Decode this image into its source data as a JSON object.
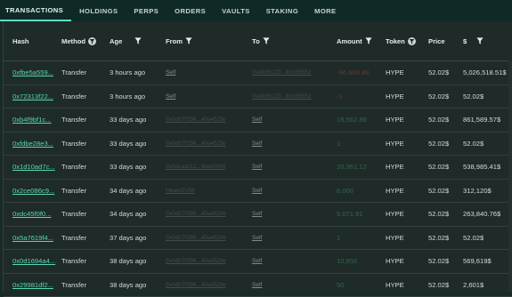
{
  "nav": {
    "items": [
      "TRANSACTIONS",
      "HOLDINGS",
      "PERPS",
      "ORDERS",
      "VAULTS",
      "STAKING",
      "MORE"
    ],
    "active_index": 0
  },
  "table": {
    "headers": {
      "hash": "Hash",
      "method": "Method",
      "age": "Age",
      "from": "From",
      "to": "To",
      "amount": "Amount",
      "token": "Token",
      "price": "Price",
      "usd": "$"
    },
    "rows": [
      {
        "hash": "0xfbe5a559...",
        "method": "Transfer",
        "age": "3 hours ago",
        "from": "Self",
        "to": "0xab3fc22f...8c085552",
        "amount": "-96,609.48",
        "amount_sign": "neg",
        "token": "HYPE",
        "price": "52.02$",
        "usd": "5,026,518.51$"
      },
      {
        "hash": "0x72313f22...",
        "method": "Transfer",
        "age": "3 hours ago",
        "from": "Self",
        "to": "0xab3fc22f...8c085552",
        "amount": "-1",
        "amount_sign": "neg",
        "token": "HYPE",
        "price": "52.02$",
        "usd": "52.02$"
      },
      {
        "hash": "0xb4f9bf1c...",
        "method": "Transfer",
        "age": "33 days ago",
        "from": "0x0d07f296...40a452fe",
        "to": "Self",
        "amount": "16,562.86",
        "amount_sign": "pos",
        "token": "HYPE",
        "price": "52.02$",
        "usd": "861,589.57$"
      },
      {
        "hash": "0xfdbe28e3...",
        "method": "Transfer",
        "age": "33 days ago",
        "from": "0x0d07f296...40a452fe",
        "to": "Self",
        "amount": "1",
        "amount_sign": "pos",
        "token": "HYPE",
        "price": "52.02$",
        "usd": "52.02$"
      },
      {
        "hash": "0x1d10ad7c...",
        "method": "Transfer",
        "age": "33 days ago",
        "from": "0x5dcaaf12...6ba00f04",
        "to": "Self",
        "amount": "10,361.12",
        "amount_sign": "pos",
        "token": "HYPE",
        "price": "52.02$",
        "usd": "538,985.41$"
      },
      {
        "hash": "0x2ce086c9...",
        "method": "Transfer",
        "age": "34 days ago",
        "from": "HeaerEVM",
        "to": "Self",
        "amount": "6,000",
        "amount_sign": "pos",
        "token": "HYPE",
        "price": "52.02$",
        "usd": "312,120$"
      },
      {
        "hash": "0xdc45f0f0...",
        "method": "Transfer",
        "age": "34 days ago",
        "from": "0x0d07f296...40a452fe",
        "to": "Self",
        "amount": "5,071.91",
        "amount_sign": "pos",
        "token": "HYPE",
        "price": "52.02$",
        "usd": "263,840.76$"
      },
      {
        "hash": "0x5a7619f4...",
        "method": "Transfer",
        "age": "37 days ago",
        "from": "0x0d07f296...40a452fe",
        "to": "Self",
        "amount": "1",
        "amount_sign": "pos",
        "token": "HYPE",
        "price": "52.02$",
        "usd": "52.02$"
      },
      {
        "hash": "0x0d1694a4...",
        "method": "Transfer",
        "age": "38 days ago",
        "from": "0x0d07f296...40a452fe",
        "to": "Self",
        "amount": "10,950",
        "amount_sign": "pos",
        "token": "HYPE",
        "price": "52.02$",
        "usd": "569,619$"
      },
      {
        "hash": "0x29981df2...",
        "method": "Transfer",
        "age": "38 days ago",
        "from": "0x0d07f296...40a452fe",
        "to": "Self",
        "amount": "50",
        "amount_sign": "pos",
        "token": "HYPE",
        "price": "52.02$",
        "usd": "2,601$"
      }
    ]
  },
  "colors": {
    "accent": "#58d6b5",
    "negative": "#e0524c",
    "positive": "#5fc98a",
    "background": "#1e2b29",
    "nav_background": "#0f2a26"
  },
  "icons": {
    "filter": "filter-icon",
    "filter_round": "filter-circle-icon"
  }
}
